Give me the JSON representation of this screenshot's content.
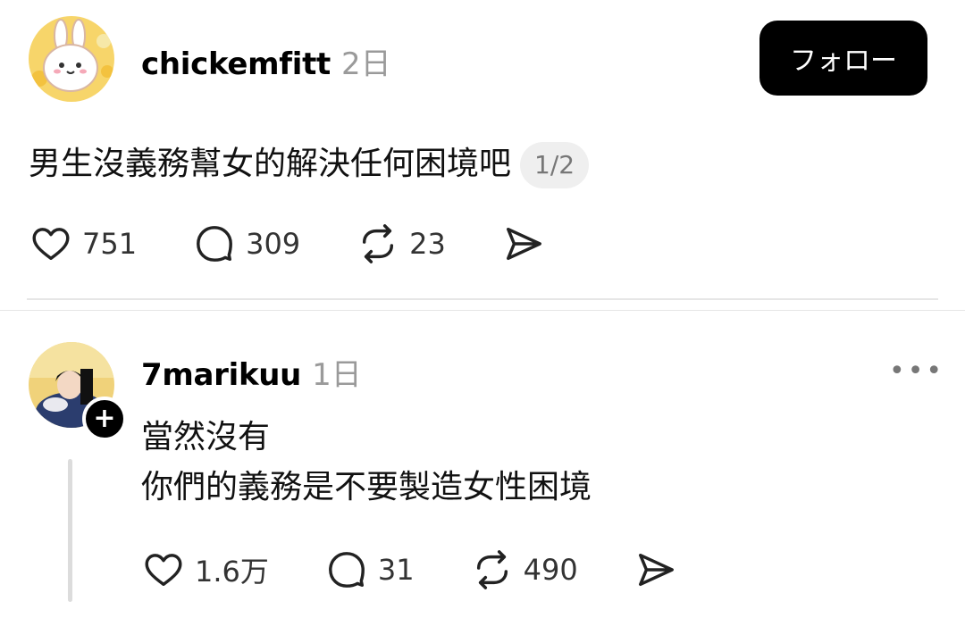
{
  "post": {
    "username": "chickemfitt",
    "time": "2日",
    "follow_label": "フォロー",
    "text": "男生沒義務幫女的解決任何困境吧",
    "page_badge": "1/2",
    "likes": "751",
    "comments": "309",
    "reposts": "23"
  },
  "reply": {
    "username": "7marikuu",
    "time": "1日",
    "line1": "當然沒有",
    "line2": "你們的義務是不要製造女性困境",
    "likes": "1.6万",
    "comments": "31",
    "reposts": "490"
  },
  "icons": [
    "heart-icon",
    "comment-icon",
    "repost-icon",
    "share-icon",
    "more-icon",
    "plus-icon"
  ]
}
